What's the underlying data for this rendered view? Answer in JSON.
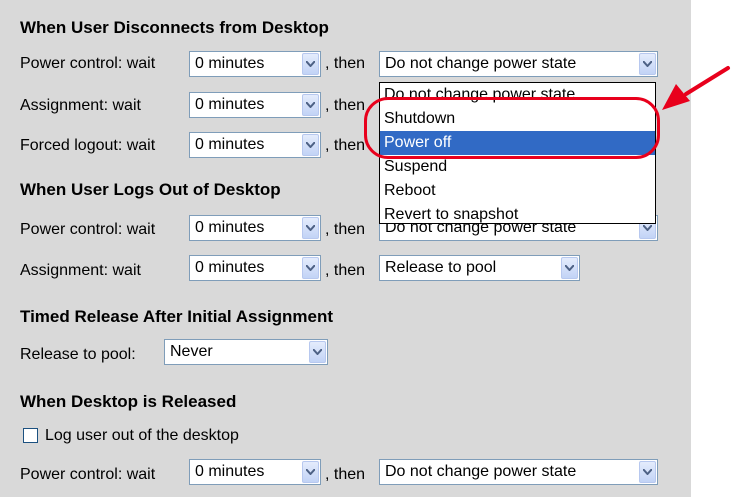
{
  "sections": {
    "disconnect": {
      "title": "When User Disconnects from Desktop",
      "rows": [
        {
          "label": "Power control: wait",
          "wait": "0 minutes",
          "then": ", then",
          "action": "Do not change power state"
        },
        {
          "label": "Assignment:   wait",
          "wait": "0 minutes",
          "then": ", then"
        },
        {
          "label": "Forced logout: wait",
          "wait": "0 minutes",
          "then": ", then"
        }
      ]
    },
    "logout": {
      "title": "When User Logs Out of Desktop",
      "rows": [
        {
          "label": "Power control: wait",
          "wait": "0 minutes",
          "then": ", then",
          "action": "Do not change power state"
        },
        {
          "label": "Assignment:   wait",
          "wait": "0 minutes",
          "then": ", then",
          "action": "Release to pool"
        }
      ]
    },
    "timed": {
      "title": "Timed Release After Initial Assignment",
      "label": "Release to pool:",
      "value": "Never"
    },
    "released": {
      "title": "When Desktop is Released",
      "checkbox_label": "Log user out of the desktop",
      "checkbox_checked": false,
      "row": {
        "label": "Power control: wait",
        "wait": "0 minutes",
        "then": ", then",
        "action": "Do not change power state"
      }
    }
  },
  "dropdown": {
    "options": [
      "Do not change power state",
      "Shutdown",
      "Power off",
      "Suspend",
      "Reboot",
      "Revert to snapshot"
    ],
    "highlighted": "Power off"
  },
  "colors": {
    "panel": "#d9d9d9",
    "annotation": "#e8001c",
    "selection": "#316ac5"
  }
}
